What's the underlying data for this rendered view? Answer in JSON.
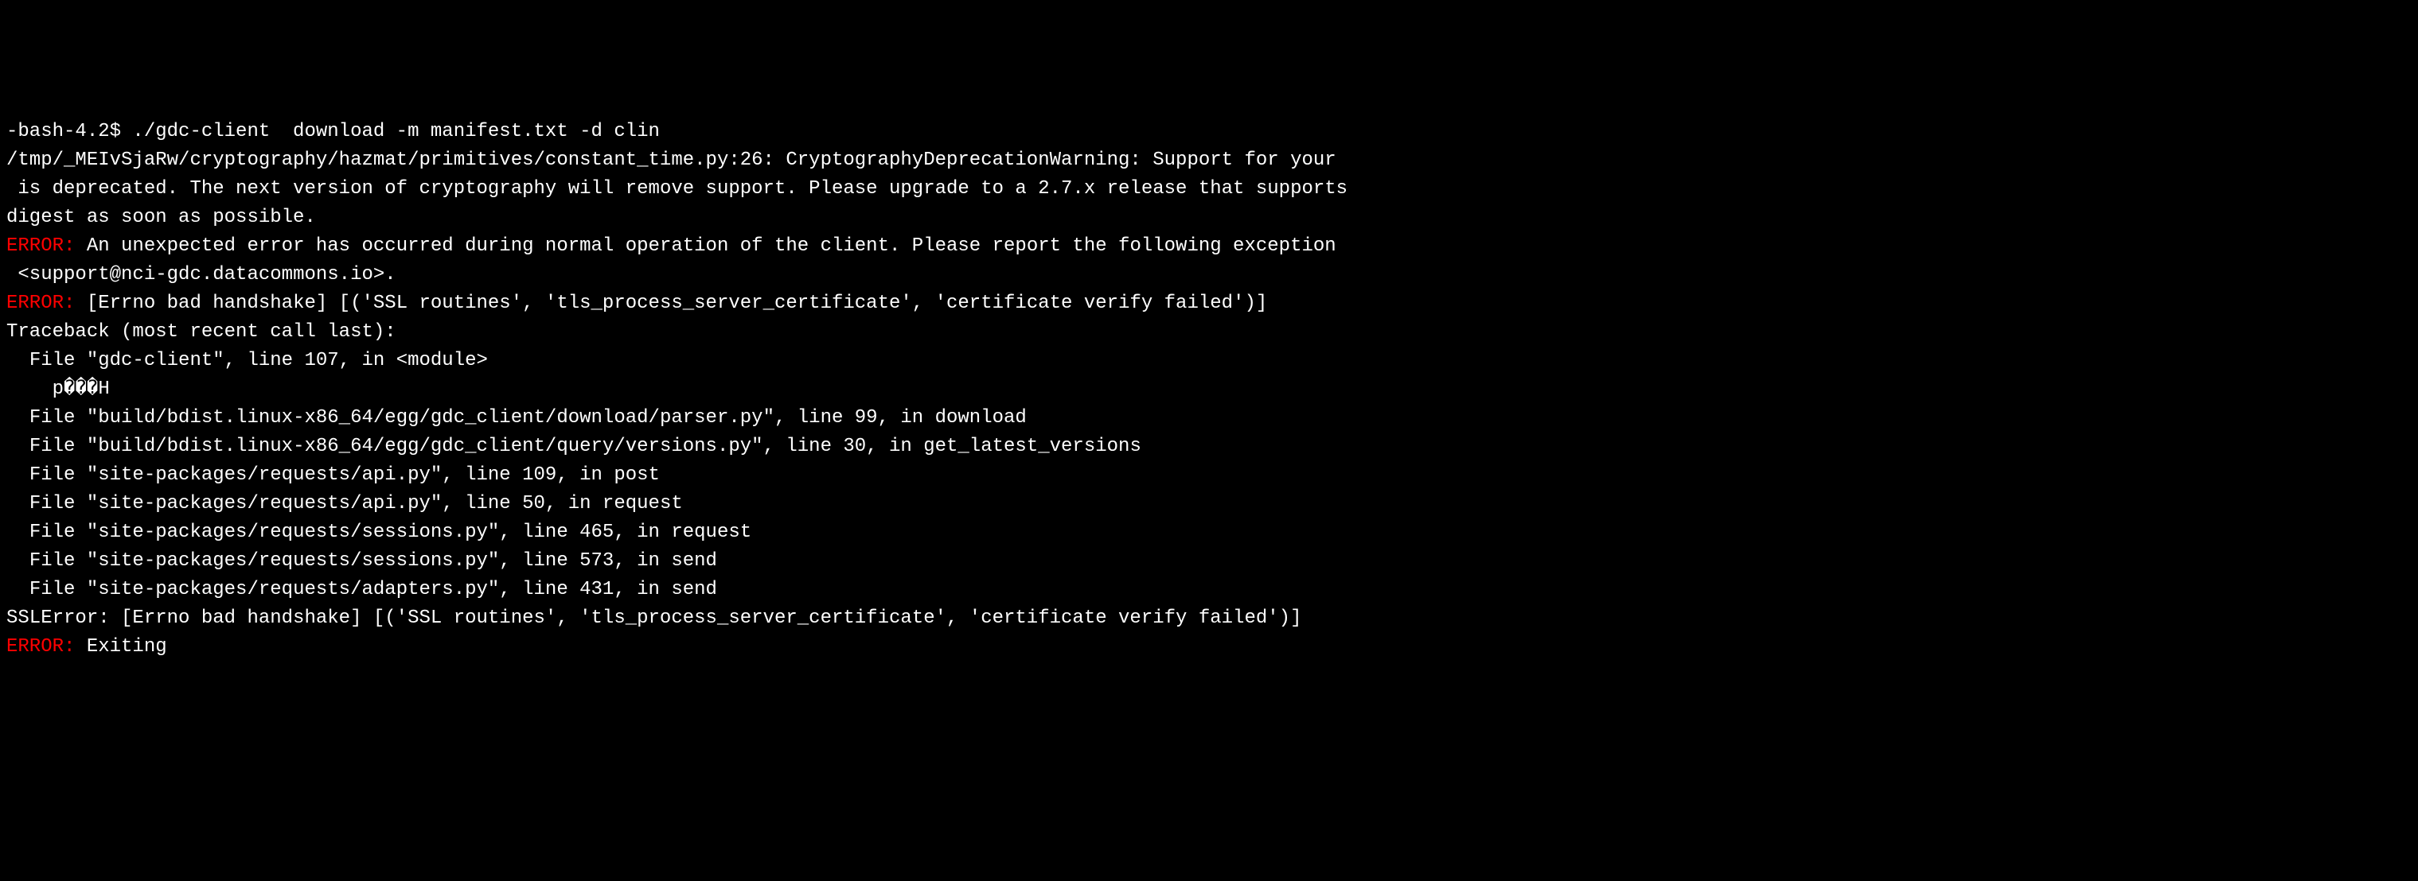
{
  "terminal": {
    "lines": [
      {
        "segments": [
          {
            "text": "-bash-4.2$ ./gdc-client  download -m manifest.txt -d clin",
            "class": "normal"
          }
        ]
      },
      {
        "segments": [
          {
            "text": "/tmp/_MEIvSjaRw/cryptography/hazmat/primitives/constant_time.py:26: CryptographyDeprecationWarning: Support for your",
            "class": "normal"
          }
        ]
      },
      {
        "segments": [
          {
            "text": " is deprecated. The next version of cryptography will remove support. Please upgrade to a 2.7.x release that supports",
            "class": "normal"
          }
        ]
      },
      {
        "segments": [
          {
            "text": "digest as soon as possible.",
            "class": "normal"
          }
        ]
      },
      {
        "segments": [
          {
            "text": "ERROR:",
            "class": "error-label"
          },
          {
            "text": " An unexpected error has occurred during normal operation of the client. Please report the following exception",
            "class": "normal"
          }
        ]
      },
      {
        "segments": [
          {
            "text": " <support@nci-gdc.datacommons.io>.",
            "class": "normal"
          }
        ]
      },
      {
        "segments": [
          {
            "text": "ERROR:",
            "class": "error-label"
          },
          {
            "text": " [Errno bad handshake] [('SSL routines', 'tls_process_server_certificate', 'certificate verify failed')]",
            "class": "normal"
          }
        ]
      },
      {
        "segments": [
          {
            "text": "Traceback (most recent call last):",
            "class": "normal"
          }
        ]
      },
      {
        "segments": [
          {
            "text": "  File \"gdc-client\", line 107, in <module>",
            "class": "normal"
          }
        ]
      },
      {
        "segments": [
          {
            "text": "    p���H",
            "class": "normal"
          }
        ]
      },
      {
        "segments": [
          {
            "text": "  File \"build/bdist.linux-x86_64/egg/gdc_client/download/parser.py\", line 99, in download",
            "class": "normal"
          }
        ]
      },
      {
        "segments": [
          {
            "text": "  File \"build/bdist.linux-x86_64/egg/gdc_client/query/versions.py\", line 30, in get_latest_versions",
            "class": "normal"
          }
        ]
      },
      {
        "segments": [
          {
            "text": "  File \"site-packages/requests/api.py\", line 109, in post",
            "class": "normal"
          }
        ]
      },
      {
        "segments": [
          {
            "text": "  File \"site-packages/requests/api.py\", line 50, in request",
            "class": "normal"
          }
        ]
      },
      {
        "segments": [
          {
            "text": "  File \"site-packages/requests/sessions.py\", line 465, in request",
            "class": "normal"
          }
        ]
      },
      {
        "segments": [
          {
            "text": "  File \"site-packages/requests/sessions.py\", line 573, in send",
            "class": "normal"
          }
        ]
      },
      {
        "segments": [
          {
            "text": "  File \"site-packages/requests/adapters.py\", line 431, in send",
            "class": "normal"
          }
        ]
      },
      {
        "segments": [
          {
            "text": "SSLError: [Errno bad handshake] [('SSL routines', 'tls_process_server_certificate', 'certificate verify failed')]",
            "class": "normal"
          }
        ]
      },
      {
        "segments": [
          {
            "text": "ERROR:",
            "class": "error-label"
          },
          {
            "text": " Exiting",
            "class": "normal"
          }
        ]
      }
    ]
  }
}
